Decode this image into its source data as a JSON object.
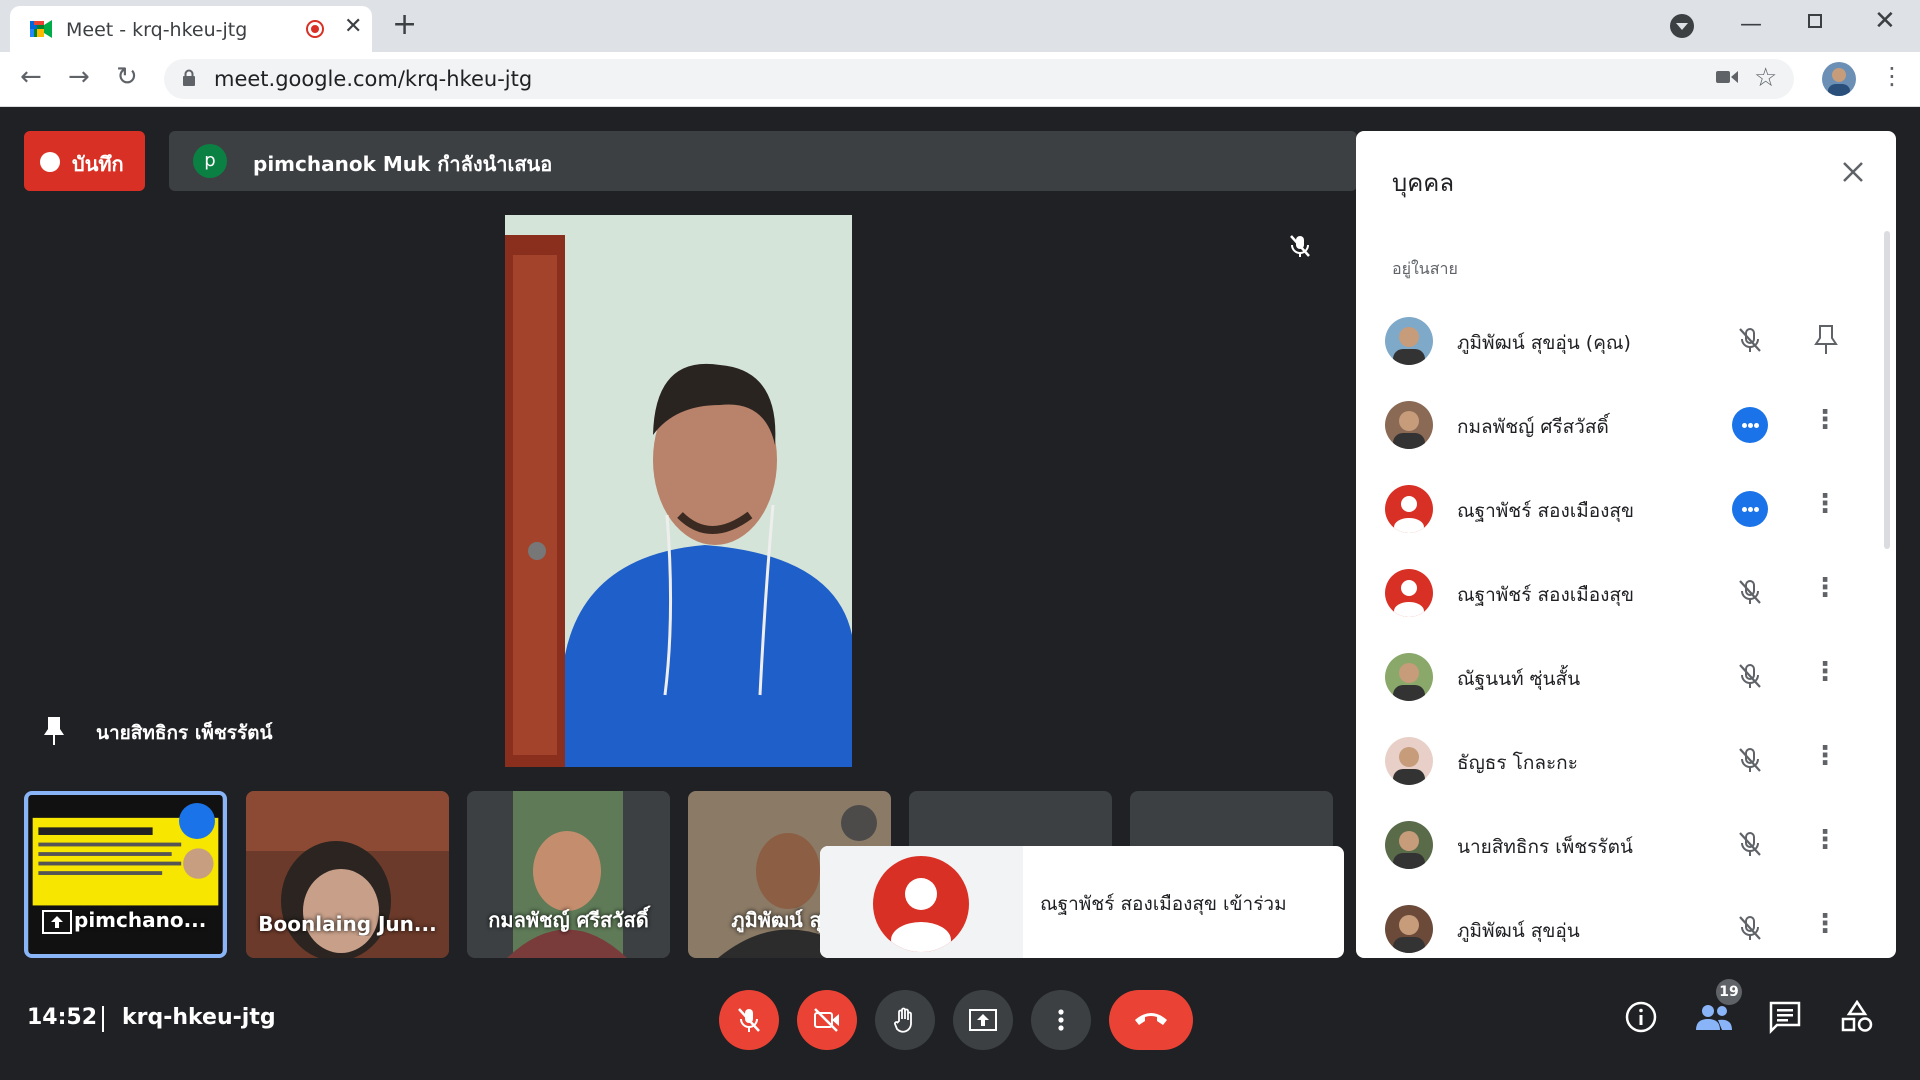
{
  "browser": {
    "tab_title": "Meet - krq-hkeu-jtg",
    "tab_close": "✕",
    "new_tab": "+",
    "url": "meet.google.com/krq-hkeu-jtg",
    "window_min": "—",
    "window_close": "✕",
    "nav_back": "←",
    "nav_forward": "→",
    "nav_reload": "↻",
    "menu": "⋮"
  },
  "meeting": {
    "record_label": "บันทึก",
    "presenter_initial": "p",
    "presenter_text": "pimchanok Muk กำลังนำเสนอ",
    "pinned_name": "นายสิทธิกร เพ็ชรรัตน์",
    "time": "14:52",
    "code": "krq-hkeu-jtg",
    "participant_count": "19"
  },
  "thumbnails": [
    {
      "name": "pimchano...",
      "active": true
    },
    {
      "name": "Boonlaing Jun..."
    },
    {
      "name": "กมลพัชญ์ ศรีสวัสดิ์"
    },
    {
      "name": "ภูมิพัฒน์ สุขอ"
    }
  ],
  "toast": {
    "text": "ณฐาพัชร์ สองเมืองสุข เข้าร่วม"
  },
  "panel": {
    "title": "บุคคล",
    "section": "อยู่ในสาย",
    "people": [
      {
        "name": "ภูมิพัฒน์ สุขอุ่น (คุณ)",
        "status": "muted",
        "action": "pin"
      },
      {
        "name": "กมลพัชญ์ ศรีสวัสดิ์",
        "status": "talking",
        "action": "more"
      },
      {
        "name": "ณฐาพัชร์ สองเมืองสุข",
        "status": "talking",
        "action": "more"
      },
      {
        "name": "ณฐาพัชร์ สองเมืองสุข",
        "status": "muted",
        "action": "more"
      },
      {
        "name": "ณัฐนนท์ ซุ่นสั้น",
        "status": "muted",
        "action": "more"
      },
      {
        "name": "ธัญธร โกละกะ",
        "status": "muted",
        "action": "more"
      },
      {
        "name": "นายสิทธิกร เพ็ชรรัตน์",
        "status": "muted",
        "action": "more"
      },
      {
        "name": "ภูมิพัฒน์ สุขอุ่น",
        "status": "muted",
        "action": "more"
      }
    ],
    "more_glyph": "⋮"
  },
  "colors": {
    "meet_bg": "#202124",
    "record_red": "#d93025",
    "hangup_red": "#ea4335",
    "talk_blue": "#1a73e8",
    "active_border": "#8ab4f8"
  },
  "icons": [
    "meet-favicon",
    "recording-icon",
    "lock-icon",
    "camera-icon",
    "star-icon",
    "mic-off-icon",
    "pin-icon",
    "close-icon",
    "more-vert-icon",
    "camera-off-icon",
    "raise-hand-icon",
    "present-screen-icon",
    "call-end-icon",
    "info-icon",
    "people-icon",
    "chat-icon",
    "activities-icon"
  ]
}
